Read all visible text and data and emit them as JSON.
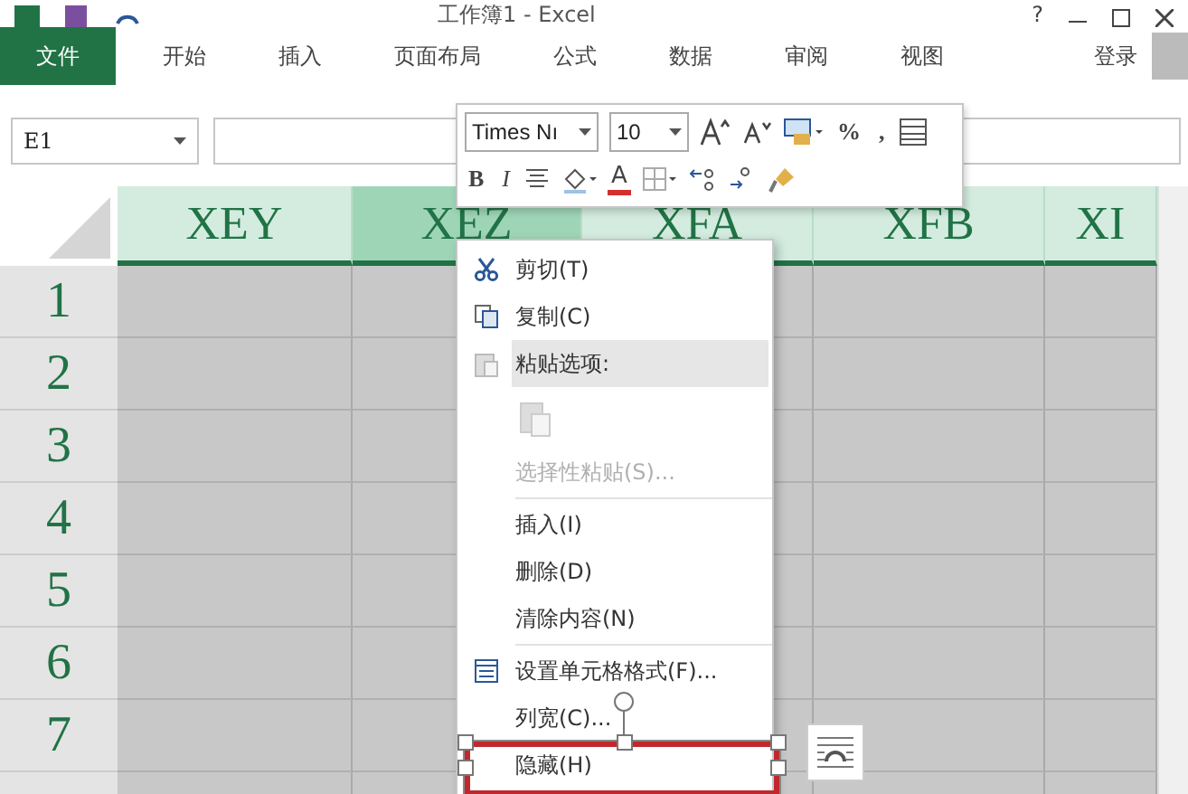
{
  "window": {
    "title": "工作簿1 - Excel",
    "controls": [
      "?"
    ]
  },
  "ribbon_tabs": [
    {
      "label": "文件",
      "selected": true
    },
    {
      "label": "开始",
      "selected": false
    },
    {
      "label": "插入",
      "selected": false
    },
    {
      "label": "页面布局",
      "selected": false
    },
    {
      "label": "公式",
      "selected": false
    },
    {
      "label": "数据",
      "selected": false
    },
    {
      "label": "审阅",
      "selected": false
    },
    {
      "label": "视图",
      "selected": false
    }
  ],
  "account": {
    "label": "登录"
  },
  "formula_bar": {
    "name_box": "E1"
  },
  "columns": [
    {
      "label": "XEY",
      "selected": false
    },
    {
      "label": "XEZ",
      "selected": true
    },
    {
      "label": "XFA",
      "selected": false
    },
    {
      "label": "XFB",
      "selected": false
    },
    {
      "label": "XI",
      "selected": false
    }
  ],
  "rows": [
    "1",
    "2",
    "3",
    "4",
    "5",
    "6",
    "7"
  ],
  "mini_toolbar": {
    "font": "Times Nı",
    "size": "10",
    "percent": "%",
    "comma": ",",
    "bold": "B",
    "italic": "I",
    "font_color": "A"
  },
  "context_menu": [
    {
      "kind": "item",
      "label": "剪切(T)",
      "disabled": false,
      "highlighted": false
    },
    {
      "kind": "item",
      "label": "复制(C)",
      "disabled": false,
      "highlighted": false
    },
    {
      "kind": "header",
      "label": "粘贴选项:",
      "disabled": false,
      "highlighted": true
    },
    {
      "kind": "paste-icons"
    },
    {
      "kind": "item",
      "label": "选择性粘贴(S)...",
      "disabled": true,
      "highlighted": false
    },
    {
      "kind": "separator"
    },
    {
      "kind": "item",
      "label": "插入(I)",
      "disabled": false,
      "highlighted": false
    },
    {
      "kind": "item",
      "label": "删除(D)",
      "disabled": false,
      "highlighted": false
    },
    {
      "kind": "item",
      "label": "清除内容(N)",
      "disabled": false,
      "highlighted": false
    },
    {
      "kind": "separator"
    },
    {
      "kind": "item",
      "label": "设置单元格格式(F)...",
      "disabled": false,
      "highlighted": false
    },
    {
      "kind": "item",
      "label": "列宽(C)...",
      "disabled": false,
      "highlighted": false
    },
    {
      "kind": "item",
      "label": "隐藏(H)",
      "disabled": false,
      "highlighted": false,
      "outlined": true
    }
  ]
}
